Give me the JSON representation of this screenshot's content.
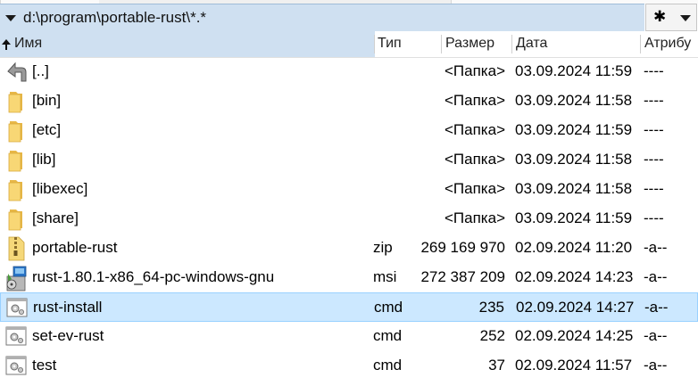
{
  "path": "d:\\program\\portable-rust\\*.*",
  "filter_symbol": "✱",
  "columns": {
    "name": "Имя",
    "type": "Тип",
    "size": "Размер",
    "date": "Дата",
    "attr": "Атрибу"
  },
  "files": [
    {
      "icon": "up-directory-icon",
      "name": "[..]",
      "type": "",
      "size": "<Папка>",
      "date": "03.09.2024 11:59",
      "attr": "----"
    },
    {
      "icon": "folder-icon",
      "name": "[bin]",
      "type": "",
      "size": "<Папка>",
      "date": "03.09.2024 11:58",
      "attr": "----"
    },
    {
      "icon": "folder-icon",
      "name": "[etc]",
      "type": "",
      "size": "<Папка>",
      "date": "03.09.2024 11:59",
      "attr": "----"
    },
    {
      "icon": "folder-icon",
      "name": "[lib]",
      "type": "",
      "size": "<Папка>",
      "date": "03.09.2024 11:58",
      "attr": "----"
    },
    {
      "icon": "folder-icon",
      "name": "[libexec]",
      "type": "",
      "size": "<Папка>",
      "date": "03.09.2024 11:58",
      "attr": "----"
    },
    {
      "icon": "folder-icon",
      "name": "[share]",
      "type": "",
      "size": "<Папка>",
      "date": "03.09.2024 11:59",
      "attr": "----"
    },
    {
      "icon": "zip-archive-icon",
      "name": "portable-rust",
      "type": "zip",
      "size": "269 169 970",
      "date": "02.09.2024 11:20",
      "attr": "-a--"
    },
    {
      "icon": "msi-installer-icon",
      "name": "rust-1.80.1-x86_64-pc-windows-gnu",
      "type": "msi",
      "size": "272 387 209",
      "date": "02.09.2024 14:23",
      "attr": "-a--"
    },
    {
      "icon": "cmd-script-icon",
      "name": "rust-install",
      "type": "cmd",
      "size": "235",
      "date": "02.09.2024 14:27",
      "attr": "-a--",
      "selected": true
    },
    {
      "icon": "cmd-script-icon",
      "name": "set-ev-rust",
      "type": "cmd",
      "size": "252",
      "date": "02.09.2024 14:25",
      "attr": "-a--"
    },
    {
      "icon": "cmd-script-icon",
      "name": "test",
      "type": "cmd",
      "size": "37",
      "date": "02.09.2024 11:57",
      "attr": "-a--"
    }
  ]
}
